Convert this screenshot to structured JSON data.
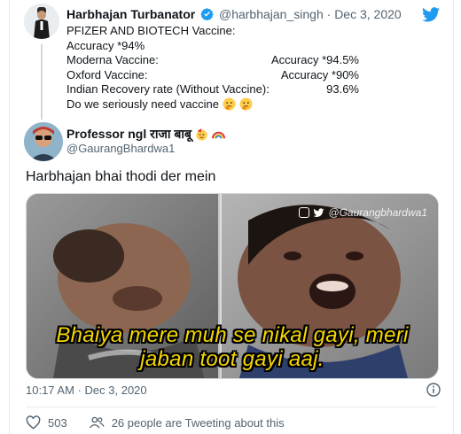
{
  "parent_tweet": {
    "display_name": "Harbhajan Turbanator",
    "handle": "@harbhajan_singh",
    "separator": "·",
    "date": "Dec 3, 2020",
    "lines": [
      {
        "label": "PFIZER AND BIOTECH Vaccine:",
        "value": ""
      },
      {
        "label": "Accuracy *94%",
        "value": ""
      },
      {
        "label": "Moderna Vaccine:",
        "value": "Accuracy *94.5%"
      },
      {
        "label": "Oxford Vaccine:",
        "value": "Accuracy *90%"
      },
      {
        "label": "Indian Recovery rate (Without Vaccine):",
        "value": "93.6%"
      },
      {
        "label": "Do we seriously need vaccine",
        "value": ""
      }
    ],
    "emojis": [
      "thinking-face",
      "thinking-face"
    ]
  },
  "main_tweet": {
    "display_name": "Professor ngl राजा बाबू",
    "name_emojis": [
      "party-face",
      "rainbow"
    ],
    "handle": "@GaurangBhardwa1",
    "text": "Harbhajan bhai thodi der mein",
    "media": {
      "watermark": "@Gaurangbhardwa1",
      "caption_line1": "Bhaiya mere muh se nikal gayi, meri",
      "caption_line2": "jaban toot gayi aaj."
    },
    "time": "10:17 AM",
    "separator": "·",
    "date": "Dec 3, 2020",
    "like_count": "503",
    "retweet_text": "26 people are Tweeting about this"
  },
  "colors": {
    "twitter_blue": "#1d9bf0",
    "text_secondary": "#536471",
    "caption_yellow": "#f5d600"
  }
}
